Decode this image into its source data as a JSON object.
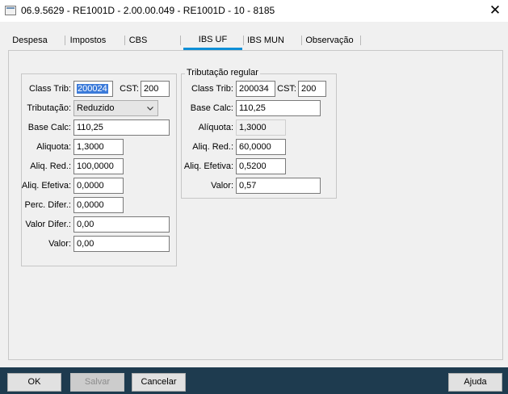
{
  "window": {
    "title": "06.9.5629 - RE1001D - 2.00.00.049 - RE1001D - 10 - 8185",
    "close_glyph": "✕"
  },
  "tabs": [
    {
      "label": "Despesa"
    },
    {
      "label": "Impostos"
    },
    {
      "label": "CBS"
    },
    {
      "label": "IBS UF",
      "active": true
    },
    {
      "label": "IBS MUN"
    },
    {
      "label": "Observação"
    }
  ],
  "left_group": {
    "class_trib": {
      "label": "Class Trib:",
      "value": "200024"
    },
    "cst": {
      "label": "CST:",
      "value": "200"
    },
    "tributacao": {
      "label": "Tributação:",
      "value": "Reduzido"
    },
    "base_calc": {
      "label": "Base Calc:",
      "value": "110,25"
    },
    "aliquota": {
      "label": "Aliquota:",
      "value": "1,3000"
    },
    "aliq_red": {
      "label": "Aliq. Red.:",
      "value": "100,0000"
    },
    "aliq_efetiva": {
      "label": "Aliq. Efetiva:",
      "value": "0,0000"
    },
    "perc_difer": {
      "label": "Perc. Difer.:",
      "value": "0,0000"
    },
    "valor_difer": {
      "label": "Valor Difer.:",
      "value": "0,00"
    },
    "valor": {
      "label": "Valor:",
      "value": "0,00"
    }
  },
  "right_group": {
    "legend": "Tributação regular",
    "class_trib": {
      "label": "Class Trib:",
      "value": "200034"
    },
    "cst": {
      "label": "CST:",
      "value": "200"
    },
    "base_calc": {
      "label": "Base Calc:",
      "value": "110,25"
    },
    "aliquota": {
      "label": "Alíquota:",
      "value": "1,3000"
    },
    "aliq_red": {
      "label": "Aliq. Red.:",
      "value": "60,0000"
    },
    "aliq_efetiva": {
      "label": "Aliq. Efetiva:",
      "value": "0,5200"
    },
    "valor": {
      "label": "Valor:",
      "value": "0,57"
    }
  },
  "buttons": {
    "ok": "OK",
    "salvar": "Salvar",
    "cancelar": "Cancelar",
    "ajuda": "Ajuda"
  },
  "colors": {
    "accent_tab": "#0e8fd6",
    "bottom_bar": "#1e3b4f",
    "selection": "#3b7ad9"
  }
}
